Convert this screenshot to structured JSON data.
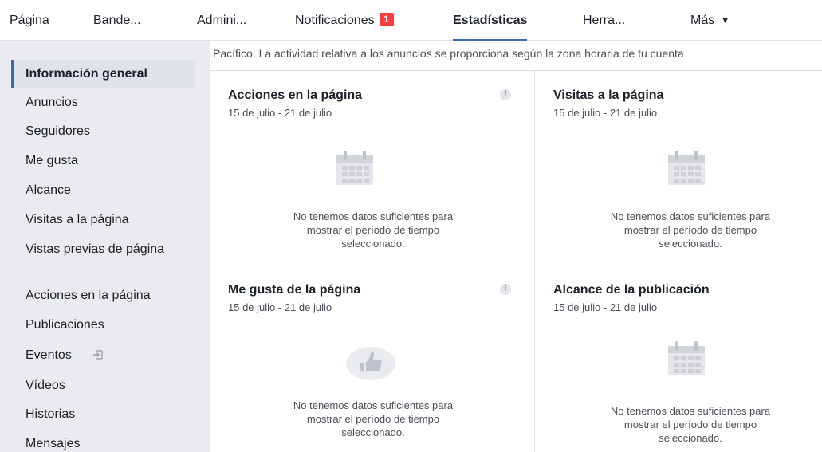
{
  "tabs": [
    {
      "label": "Página"
    },
    {
      "label": "Bande..."
    },
    {
      "label": "Admini..."
    },
    {
      "label": "Notificaciones",
      "badge": "1"
    },
    {
      "label": "Estadísticas"
    },
    {
      "label": "Herra..."
    },
    {
      "label": "Más",
      "caret": "▼"
    }
  ],
  "sidebar": {
    "items": [
      {
        "label": "Información general"
      },
      {
        "label": "Anuncios"
      },
      {
        "label": "Seguidores"
      },
      {
        "label": "Me gusta"
      },
      {
        "label": "Alcance"
      },
      {
        "label": "Visitas a la página"
      },
      {
        "label": "Vistas previas de página"
      },
      {
        "label": "Acciones en la página"
      },
      {
        "label": "Publicaciones"
      },
      {
        "label": "Eventos"
      },
      {
        "label": "Vídeos"
      },
      {
        "label": "Historias"
      },
      {
        "label": "Mensajes"
      }
    ]
  },
  "notice": "Pacífico. La actividad relativa a los anuncios se proporciona según la zona horaria de tu cuenta",
  "cards": [
    {
      "title": "Acciones en la página",
      "date": "15 de julio - 21 de julio",
      "empty_line1": "No tenemos datos suficientes para",
      "empty_line2": "mostrar el período de tiempo",
      "empty_line3": "seleccionado.",
      "info": "i"
    },
    {
      "title": "Visitas a la página",
      "date": "15 de julio - 21 de julio",
      "empty_line1": "No tenemos datos suficientes para",
      "empty_line2": "mostrar el período de tiempo",
      "empty_line3": "seleccionado."
    },
    {
      "title": "Me gusta de la página",
      "date": "15 de julio - 21 de julio",
      "empty_line1": "No tenemos datos suficientes para",
      "empty_line2": "mostrar el período de tiempo",
      "empty_line3": "seleccionado.",
      "info": "i"
    },
    {
      "title": "Alcance de la publicación",
      "date": "15 de julio - 21 de julio",
      "empty_line1": "No tenemos datos suficientes para",
      "empty_line2": "mostrar el período de tiempo",
      "empty_line3": "seleccionado."
    }
  ],
  "icons": {
    "calendar": "calendar-icon",
    "like": "thumbs-up-icon",
    "info": "info-icon",
    "event_arrow": "arrow-into-box-icon"
  },
  "colors": {
    "accent": "#4267b2",
    "badge": "#fa3e3e",
    "sidebar_bg": "#e9ebee",
    "card_bg": "#ffffff"
  }
}
